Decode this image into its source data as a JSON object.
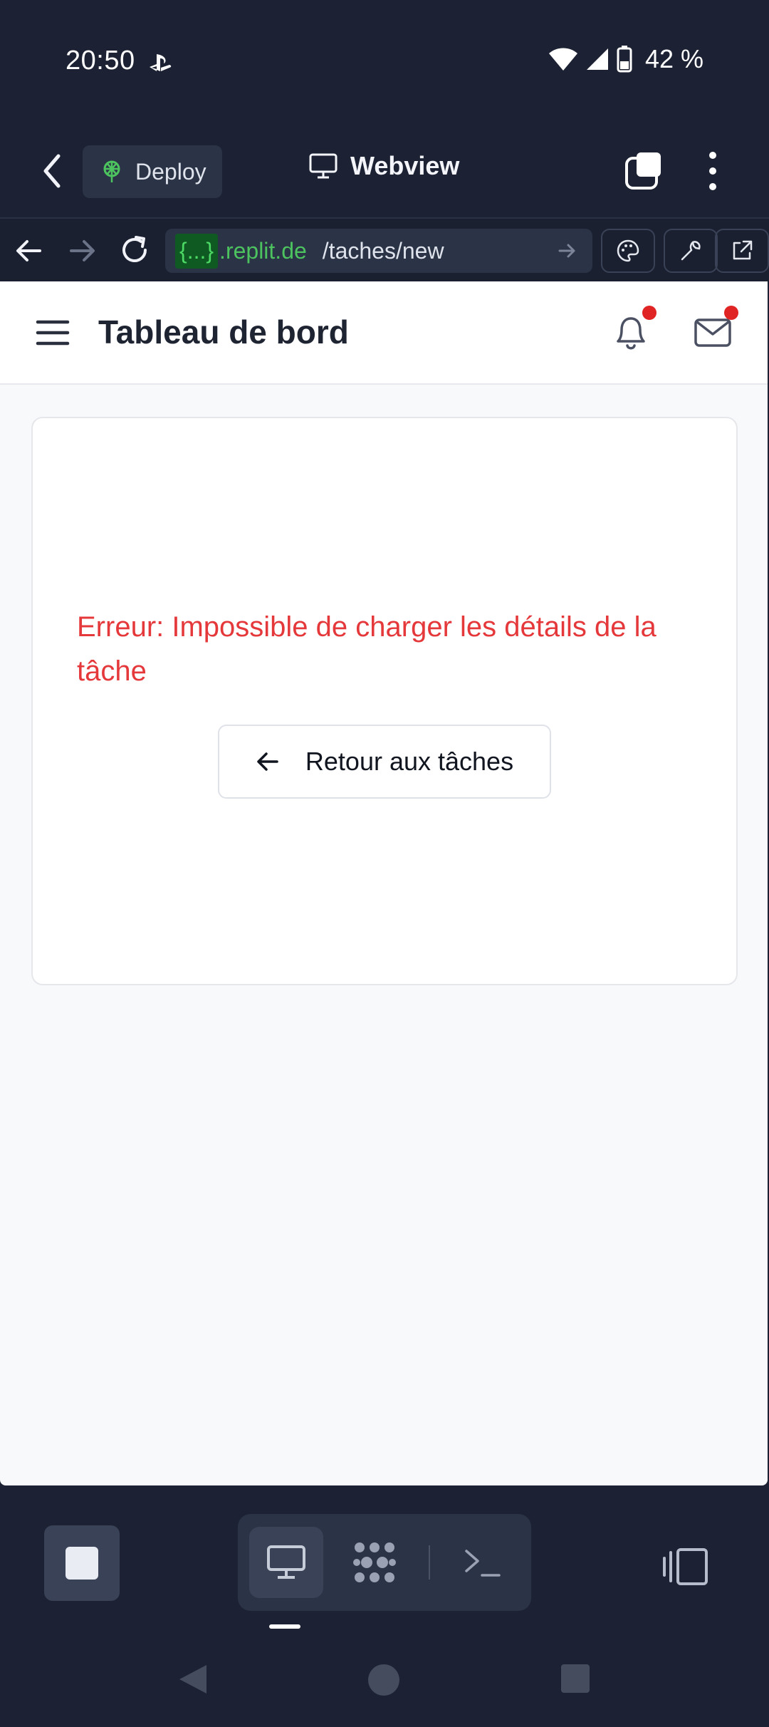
{
  "status_bar": {
    "time": "20:50",
    "battery": "42 %",
    "icons": [
      "playstation-icon",
      "wifi-icon",
      "signal-icon",
      "battery-icon"
    ]
  },
  "replit_bar": {
    "deploy_label": "Deploy",
    "title": "Webview"
  },
  "url_bar": {
    "chip": "{...}",
    "domain": ".replit.de",
    "path": "/taches/new"
  },
  "app": {
    "title": "Tableau de bord",
    "error_message": "Erreur: Impossible de charger les détails de la tâche",
    "back_button_label": "Retour aux tâches"
  },
  "colors": {
    "chrome_bg": "#1c2233",
    "error": "#e5383b",
    "badge": "#e02424",
    "url_green": "#4cc35e"
  }
}
